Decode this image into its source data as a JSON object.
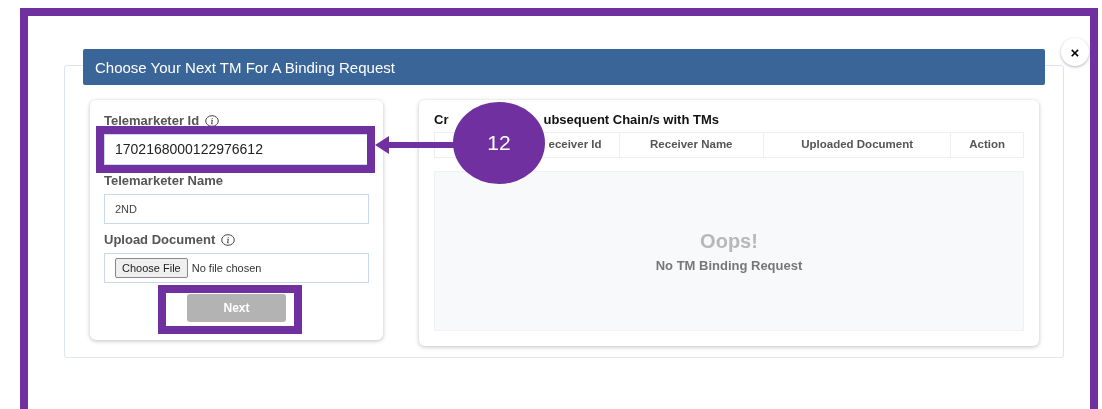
{
  "dialog": {
    "title": "Choose Your Next TM For A Binding Request",
    "close_label": "×"
  },
  "form": {
    "fields": [
      {
        "kind": "text",
        "label": "Telemarketer Id",
        "info": true,
        "value": "1702168000122976612"
      },
      {
        "kind": "text",
        "label": "Telemarketer Name",
        "info": false,
        "value": "2ND"
      },
      {
        "kind": "file",
        "label": "Upload Document",
        "info": true,
        "button": "Choose File",
        "status": "No file chosen"
      }
    ],
    "submit": {
      "label": "Next",
      "disabled": true
    }
  },
  "chains": {
    "heading_parts": [
      "Cr",
      "ubsequent Chain/s with TMs"
    ],
    "columns": [
      {
        "label": "eceiver Id"
      },
      {
        "label": "Receiver Name"
      },
      {
        "label": "Uploaded Document"
      },
      {
        "label": "Action"
      }
    ],
    "empty_state": {
      "title": "Oops!",
      "message": "No TM Binding Request"
    }
  },
  "annotation": {
    "callout": "12"
  }
}
